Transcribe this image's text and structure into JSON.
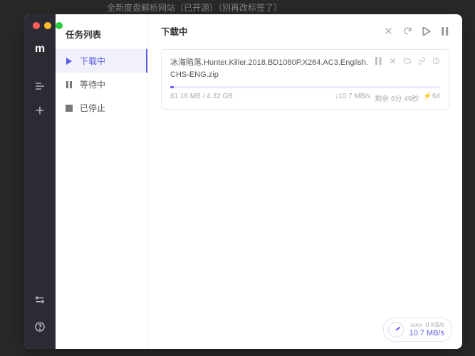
{
  "background_tab_hint": "全新度盘解析网站（已开源）（别再改标签了）",
  "sidebar": {
    "title": "任务列表",
    "items": [
      {
        "label": "下载中",
        "icon": "play-icon",
        "active": true
      },
      {
        "label": "等待中",
        "icon": "pause-icon",
        "active": false
      },
      {
        "label": "已停止",
        "icon": "stop-icon",
        "active": false
      }
    ]
  },
  "main": {
    "title": "下载中",
    "header_actions": [
      "close-icon",
      "refresh-icon",
      "play-icon",
      "pause-all-icon"
    ]
  },
  "task": {
    "filename": "冰海陷落.Hunter.Killer.2018.BD1080P.X264.AC3.English.CHS-ENG.zip",
    "size_progress": "61.16 MB / 4.32 GB",
    "speed": "↓10.7 MB/s",
    "eta": "剩余 6分 49秒",
    "peers": "⚡64",
    "actions": [
      "pause-icon",
      "close-icon",
      "folder-icon",
      "link-icon",
      "info-icon"
    ]
  },
  "speed_widget": {
    "label": "MAX",
    "up": "0 KB/s",
    "down": "10.7 MB/s"
  },
  "colors": {
    "accent": "#5b5ce2",
    "rail": "#2b2b34"
  }
}
